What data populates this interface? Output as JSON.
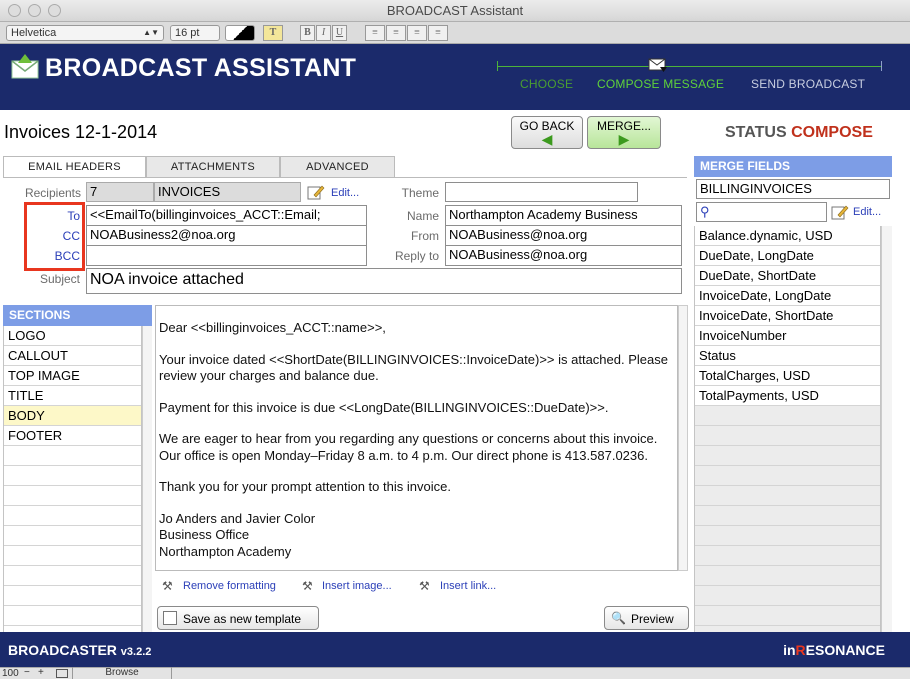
{
  "window": {
    "title": "BROADCAST Assistant"
  },
  "format_bar": {
    "font": "Helvetica",
    "size": "16 pt",
    "text_color_btn": "T",
    "bold": "B",
    "italic": "I",
    "underline": "U"
  },
  "header": {
    "app_title": "BROADCAST ASSISTANT",
    "steps": [
      "CHOOSE",
      "COMPOSE MESSAGE",
      "SEND BROADCAST"
    ]
  },
  "record": {
    "title": "Invoices 12-1-2014"
  },
  "nav": {
    "go_back": "GO BACK",
    "merge": "MERGE..."
  },
  "status": {
    "label": "STATUS",
    "value": "COMPOSE"
  },
  "tabs": [
    "EMAIL HEADERS",
    "ATTACHMENTS",
    "ADVANCED"
  ],
  "headers": {
    "recipients_label": "Recipients",
    "recipients_count": "7",
    "recipients_table": "INVOICES",
    "edit_label": "Edit...",
    "to_label": "To",
    "to_value": "<<EmailTo(billinginvoices_ACCT::Email;",
    "cc_label": "CC",
    "cc_value": "NOABusiness2@noa.org",
    "bcc_label": "BCC",
    "bcc_value": "",
    "subject_label": "Subject",
    "subject_value": "NOA invoice attached",
    "theme_label": "Theme",
    "theme_value": "",
    "name_label": "Name",
    "name_value": "Northampton Academy Business",
    "from_label": "From",
    "from_value": "NOABusiness@noa.org",
    "reply_label": "Reply to",
    "reply_value": "NOABusiness@noa.org"
  },
  "sections": {
    "title": "SECTIONS",
    "items": [
      "LOGO",
      "CALLOUT",
      "TOP IMAGE",
      "TITLE",
      "BODY",
      "FOOTER"
    ]
  },
  "body": {
    "paragraphs": [
      "Dear <<billinginvoices_ACCT::name>>,",
      "Your invoice dated <<ShortDate(BILLINGINVOICES::InvoiceDate)>> is attached. Please review your charges and balance due.",
      "Payment for this invoice is due <<LongDate(BILLINGINVOICES::DueDate)>>.",
      "We are eager to hear from you regarding any questions or concerns about this invoice. Our office is open Monday–Friday 8 a.m. to 4 p.m. Our direct phone is 413.587.0236.",
      "Thank you for your prompt attention to this invoice."
    ],
    "signature": [
      "Jo Anders and Javier Color",
      "Business Office",
      "Northampton Academy"
    ]
  },
  "tools": {
    "remove_formatting": "Remove formatting",
    "insert_image": "Insert image...",
    "insert_link": "Insert link..."
  },
  "buttons": {
    "save_template": "Save as new template",
    "preview": "Preview"
  },
  "merge_fields": {
    "title": "MERGE FIELDS",
    "table": "BILLINGINVOICES",
    "edit_label": "Edit...",
    "items": [
      "Balance.dynamic, USD",
      "DueDate, LongDate",
      "DueDate, ShortDate",
      "InvoiceDate, LongDate",
      "InvoiceDate, ShortDate",
      "InvoiceNumber",
      "Status",
      "TotalCharges, USD",
      "TotalPayments, USD"
    ]
  },
  "footer": {
    "app": "BROADCASTER",
    "version": "v3.2.2",
    "brand_prefix": "in",
    "brand_accent": "R",
    "brand_suffix": "ESONANCE"
  },
  "statusbar": {
    "zoom": "100",
    "mode": "Browse"
  },
  "colors": {
    "navy": "#1b2a6b",
    "accent_red": "#c0311c",
    "step_green": "#34a814",
    "panel_blue": "#7d9de6",
    "highlight": "#fdf8c8",
    "annotation_red": "#e8361f"
  }
}
